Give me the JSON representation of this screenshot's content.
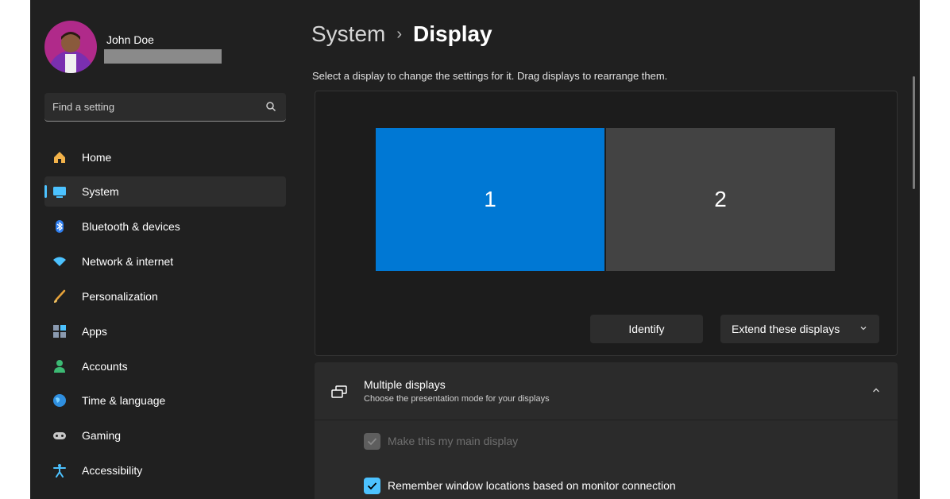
{
  "user": {
    "name": "John Doe"
  },
  "search": {
    "placeholder": "Find a setting"
  },
  "sidebar": {
    "items": [
      {
        "label": "Home",
        "icon": "home-icon"
      },
      {
        "label": "System",
        "icon": "system-icon",
        "active": true
      },
      {
        "label": "Bluetooth & devices",
        "icon": "bluetooth-icon"
      },
      {
        "label": "Network & internet",
        "icon": "wifi-icon"
      },
      {
        "label": "Personalization",
        "icon": "brush-icon"
      },
      {
        "label": "Apps",
        "icon": "apps-icon"
      },
      {
        "label": "Accounts",
        "icon": "accounts-icon"
      },
      {
        "label": "Time & language",
        "icon": "globe-icon"
      },
      {
        "label": "Gaming",
        "icon": "gamepad-icon"
      },
      {
        "label": "Accessibility",
        "icon": "accessibility-icon"
      }
    ]
  },
  "breadcrumb": {
    "parent": "System",
    "separator": "›",
    "current": "Display"
  },
  "arrange": {
    "description": "Select a display to change the settings for it. Drag displays to rearrange them.",
    "monitors": [
      "1",
      "2"
    ],
    "identify_label": "Identify",
    "mode_label": "Extend these displays"
  },
  "multiple_displays": {
    "title": "Multiple displays",
    "subtitle": "Choose the presentation mode for your displays",
    "options": [
      {
        "label": "Make this my main display",
        "checked": true,
        "disabled": true
      },
      {
        "label": "Remember window locations based on monitor connection",
        "checked": true,
        "disabled": false
      }
    ]
  },
  "colors": {
    "accent": "#4cc2ff",
    "selected_monitor": "#0078d4",
    "window_bg": "#202020"
  }
}
